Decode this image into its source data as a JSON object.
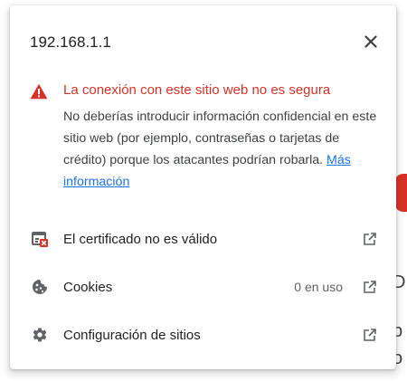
{
  "site_info": {
    "host": "192.168.1.1",
    "close_icon": "close-icon",
    "warning": {
      "icon": "warning-triangle-icon",
      "color": "#d93025",
      "title": "La conexión con este sitio web no es segura",
      "body": "No deberías introducir información confidencial en este sitio web (por ejemplo, contraseñas o tarjetas de crédito) porque los atacantes podrían robarla.",
      "link_label": "Más información",
      "link_color": "#1a73e8"
    },
    "rows": [
      {
        "label": "El certificado no es válido",
        "icon": "certificate-invalid-icon",
        "status": "",
        "trailing_icon": "open-in-new-icon"
      },
      {
        "label": "Cookies",
        "icon": "cookie-icon",
        "status": "0 en uso",
        "trailing_icon": "open-in-new-icon"
      },
      {
        "label": "Configuración de sitios",
        "icon": "gear-icon",
        "status": "",
        "trailing_icon": "open-in-new-icon"
      }
    ]
  }
}
